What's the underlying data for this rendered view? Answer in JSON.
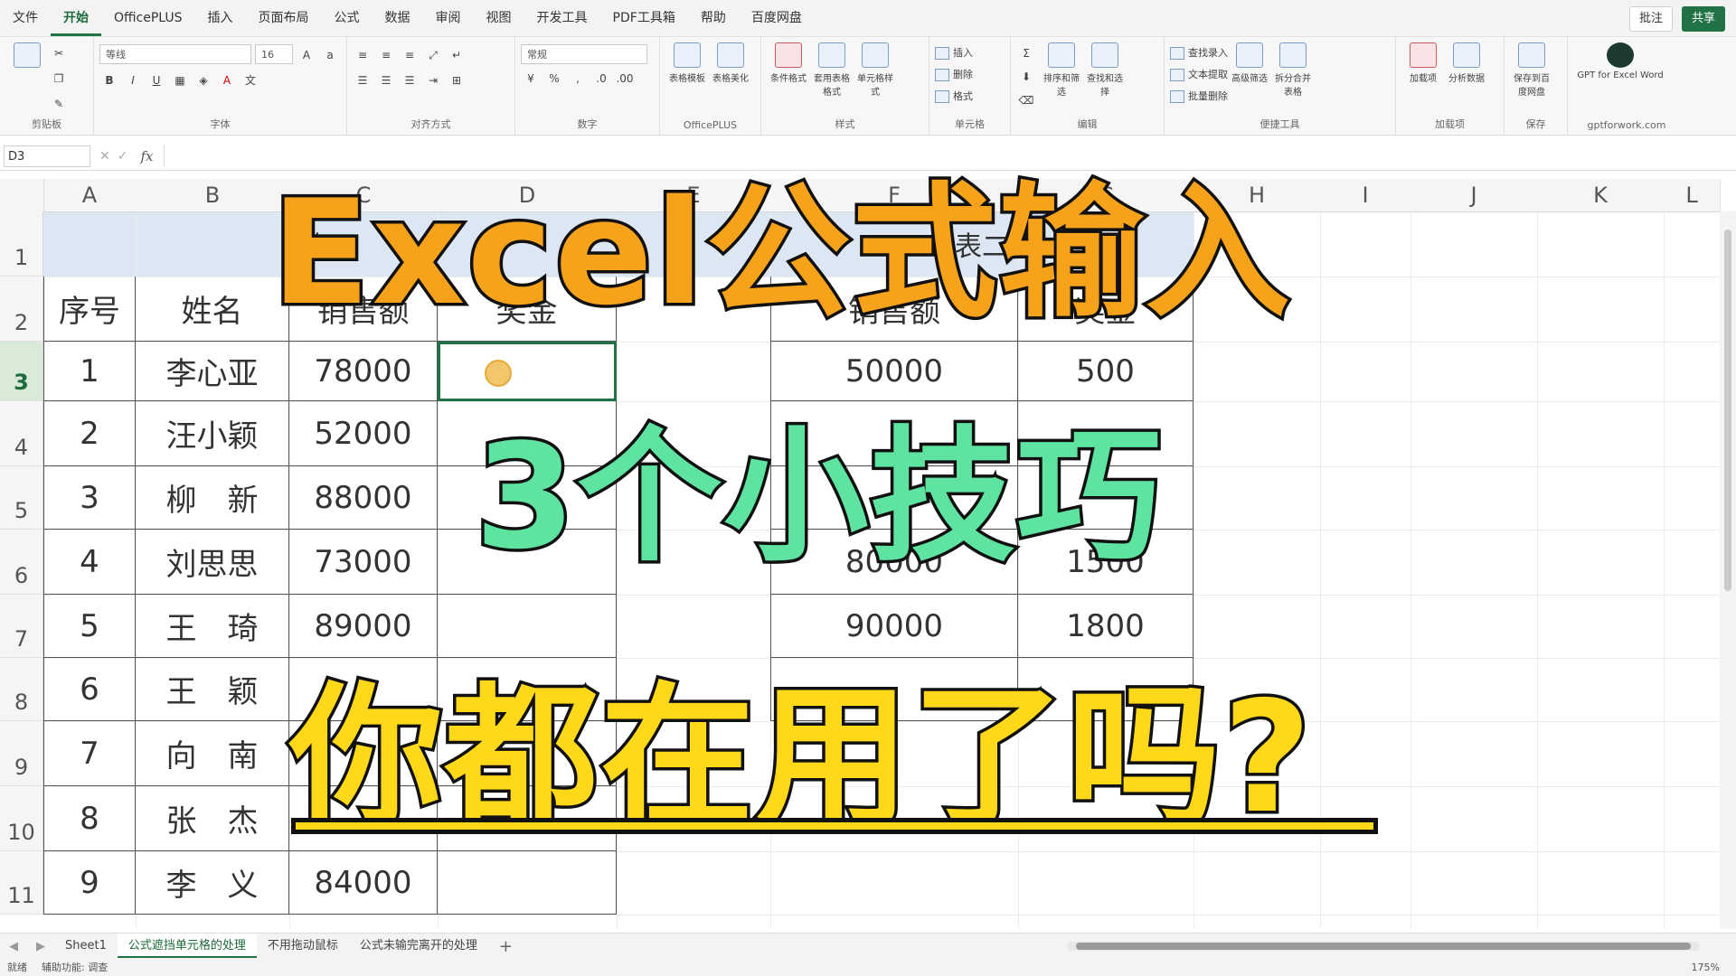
{
  "menu": {
    "items": [
      "文件",
      "开始",
      "OfficePLUS",
      "插入",
      "页面布局",
      "公式",
      "数据",
      "审阅",
      "视图",
      "开发工具",
      "PDF工具箱",
      "帮助",
      "百度网盘"
    ],
    "active_index": 1,
    "comment_btn": "批注",
    "share_btn": "共享"
  },
  "ribbon": {
    "groups": {
      "clipboard": "剪贴板",
      "font": "字体",
      "align": "对齐方式",
      "number": "数字",
      "officeplus": "OfficePLUS",
      "style": "样式",
      "cells": "单元格",
      "edit": "编辑",
      "tools": "便捷工具",
      "addins": "加载项",
      "save": "保存",
      "gpt": "gptforwork.com"
    },
    "font_name": "等线",
    "font_size": "16",
    "number_format": "常规",
    "buttons": {
      "table_template": "表格模板",
      "table_beautify": "表格美化",
      "conditional": "条件格式",
      "format_table": "套用表格格式",
      "cell_style": "单元格样式",
      "insert": "插入",
      "delete": "删除",
      "format": "格式",
      "sort_filter": "排序和筛选",
      "find_select": "查找和选择",
      "find_entry": "查找录入",
      "text_extract": "文本提取",
      "batch_delete": "批量删除",
      "advanced_filter": "高级筛选",
      "split_merge": "拆分合并表格",
      "addins_btn": "加载项",
      "analyze": "分析数据",
      "save_baidu": "保存到百度网盘",
      "gpt": "GPT for Excel Word"
    }
  },
  "formula_bar": {
    "name_box": "D3",
    "fx": "fx"
  },
  "grid": {
    "columns": [
      "A",
      "B",
      "C",
      "D",
      "E",
      "F",
      "G",
      "H",
      "I",
      "J",
      "K",
      "L"
    ],
    "rows": [
      "1",
      "2",
      "3",
      "4",
      "5",
      "6",
      "7",
      "8",
      "9",
      "10",
      "11"
    ],
    "selected_row": "3",
    "table1": {
      "title": "表一",
      "headers": [
        "序号",
        "姓名",
        "销售额",
        "奖金"
      ],
      "rows": [
        [
          "1",
          "李心亚",
          "78000",
          ""
        ],
        [
          "2",
          "汪小颖",
          "52000",
          ""
        ],
        [
          "3",
          "柳　新",
          "88000",
          ""
        ],
        [
          "4",
          "刘思思",
          "73000",
          ""
        ],
        [
          "5",
          "王　琦",
          "89000",
          ""
        ],
        [
          "6",
          "王　颖",
          "",
          ""
        ],
        [
          "7",
          "向　南",
          "",
          ""
        ],
        [
          "8",
          "张　杰",
          "",
          ""
        ],
        [
          "9",
          "李　义",
          "84000",
          ""
        ]
      ]
    },
    "table2": {
      "title": "表二",
      "headers": [
        "销售额",
        "奖金"
      ],
      "rows": [
        [
          "50000",
          "500"
        ],
        [
          "",
          ""
        ],
        [
          "",
          ""
        ],
        [
          "80000",
          "1500"
        ],
        [
          "90000",
          "1800"
        ],
        [
          "",
          ""
        ]
      ]
    }
  },
  "overlay": {
    "line1": "Excel公式输入",
    "line2": "3个小技巧",
    "line3": "你都在用了吗?"
  },
  "sheet_tabs": [
    "Sheet1",
    "公式遮挡单元格的处理",
    "不用拖动鼠标",
    "公式未输完离开的处理"
  ],
  "active_tab": 1,
  "status": {
    "ready": "就绪",
    "accessibility": "辅助功能: 调查",
    "zoom": "175%"
  }
}
